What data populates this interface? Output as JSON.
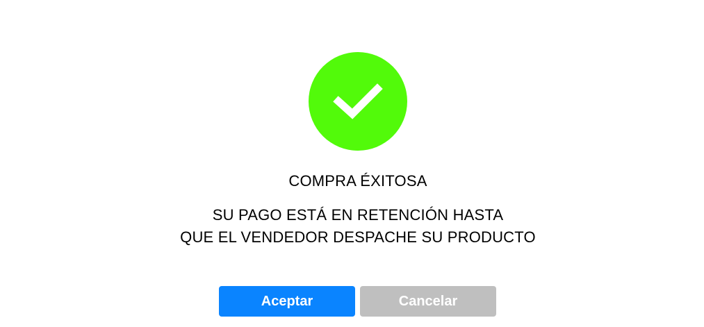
{
  "dialog": {
    "icon": "checkmark-icon",
    "icon_color": "#52FA0A",
    "title": "COMPRA ÉXITOSA",
    "message_lines": [
      "SU PAGO ESTÁ EN RETENCIÓN HASTA",
      "QUE EL VENDEDOR DESPACHE SU PRODUCTO"
    ],
    "accept_label": "Aceptar",
    "cancel_label": "Cancelar",
    "accept_color": "#0A84FF",
    "cancel_color": "#BFBFBF"
  }
}
